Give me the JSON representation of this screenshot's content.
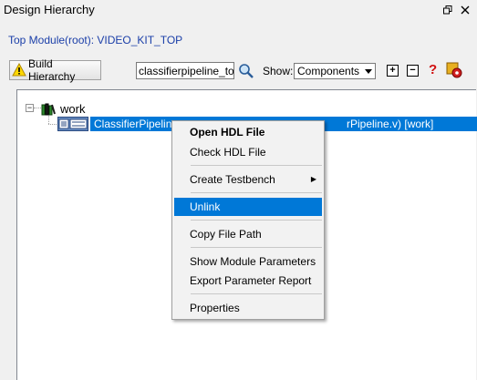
{
  "window": {
    "title": "Design Hierarchy"
  },
  "top_module": {
    "text": "Top Module(root): VIDEO_KIT_TOP"
  },
  "toolbar": {
    "build_label": "Build Hierarchy",
    "search_value": "classifierpipeline_top",
    "show_label": "Show:",
    "show_value": "Components",
    "expand_symbol": "+",
    "collapse_symbol": "−",
    "help_symbol": "?"
  },
  "tree": {
    "library": "work",
    "module_name": "ClassifierPipeline",
    "module_suffix": "rPipeline.v) [work]"
  },
  "context_menu": {
    "items": [
      {
        "label": "Open HDL File"
      },
      {
        "label": "Check HDL File"
      },
      {
        "label": "Create Testbench"
      },
      {
        "label": "Unlink"
      },
      {
        "label": "Copy File Path"
      },
      {
        "label": "Show Module Parameters"
      },
      {
        "label": "Export Parameter Report"
      },
      {
        "label": "Properties"
      }
    ],
    "submenu_arrow": "▶"
  },
  "colors": {
    "selection": "#0078d7",
    "link_blue": "#1a3ea8",
    "help_red": "#d01010"
  },
  "icons": [
    "restore-icon",
    "close-icon",
    "warning-icon",
    "search-icon",
    "dropdown-arrow-icon",
    "expand-icon",
    "collapse-icon",
    "help-icon",
    "settings-icon",
    "library-icon",
    "hdl-file-icon"
  ]
}
